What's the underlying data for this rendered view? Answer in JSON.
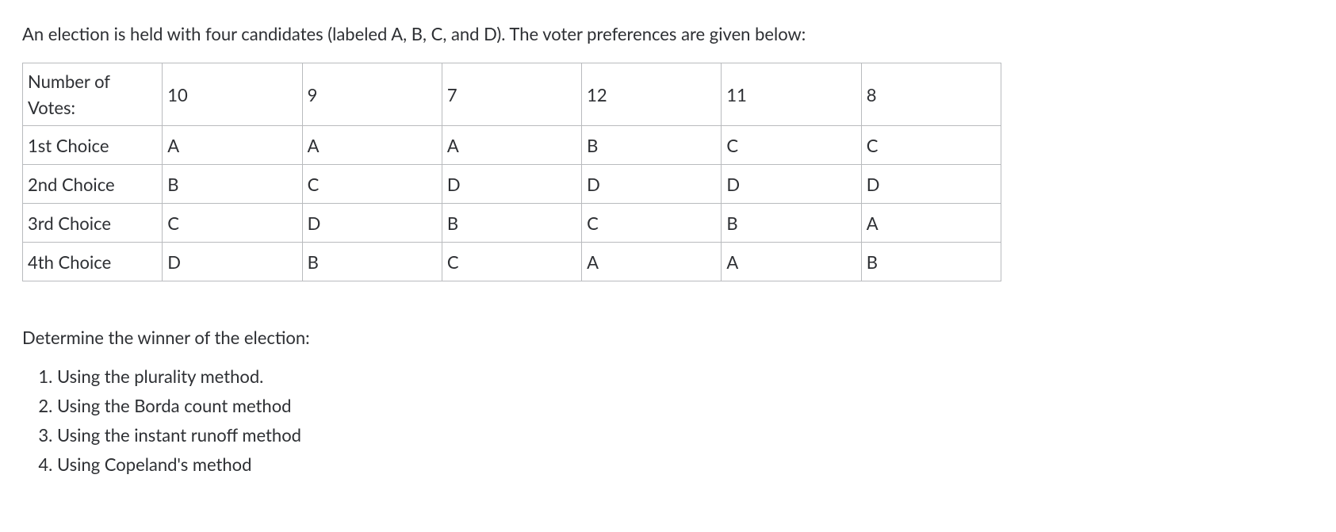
{
  "intro_text": "An election is held with four candidates (labeled A, B, C, and D). The voter preferences are given below:",
  "table": {
    "header_label": "Number of Votes:",
    "vote_counts": [
      "10",
      "9",
      "7",
      "12",
      "11",
      "8"
    ],
    "rows": [
      {
        "label": "1st Choice",
        "cells": [
          "A",
          "A",
          "A",
          "B",
          "C",
          "C"
        ]
      },
      {
        "label": "2nd Choice",
        "cells": [
          "B",
          "C",
          "D",
          "D",
          "D",
          "D"
        ]
      },
      {
        "label": "3rd Choice",
        "cells": [
          "C",
          "D",
          "B",
          "C",
          "B",
          "A"
        ]
      },
      {
        "label": "4th Choice",
        "cells": [
          "D",
          "B",
          "C",
          "A",
          "A",
          "B"
        ]
      }
    ]
  },
  "prompt_text": "Determine the winner of the election:",
  "methods": [
    "Using the plurality method.",
    "Using the Borda count method",
    "Using the instant runoff method",
    "Using Copeland's method"
  ]
}
